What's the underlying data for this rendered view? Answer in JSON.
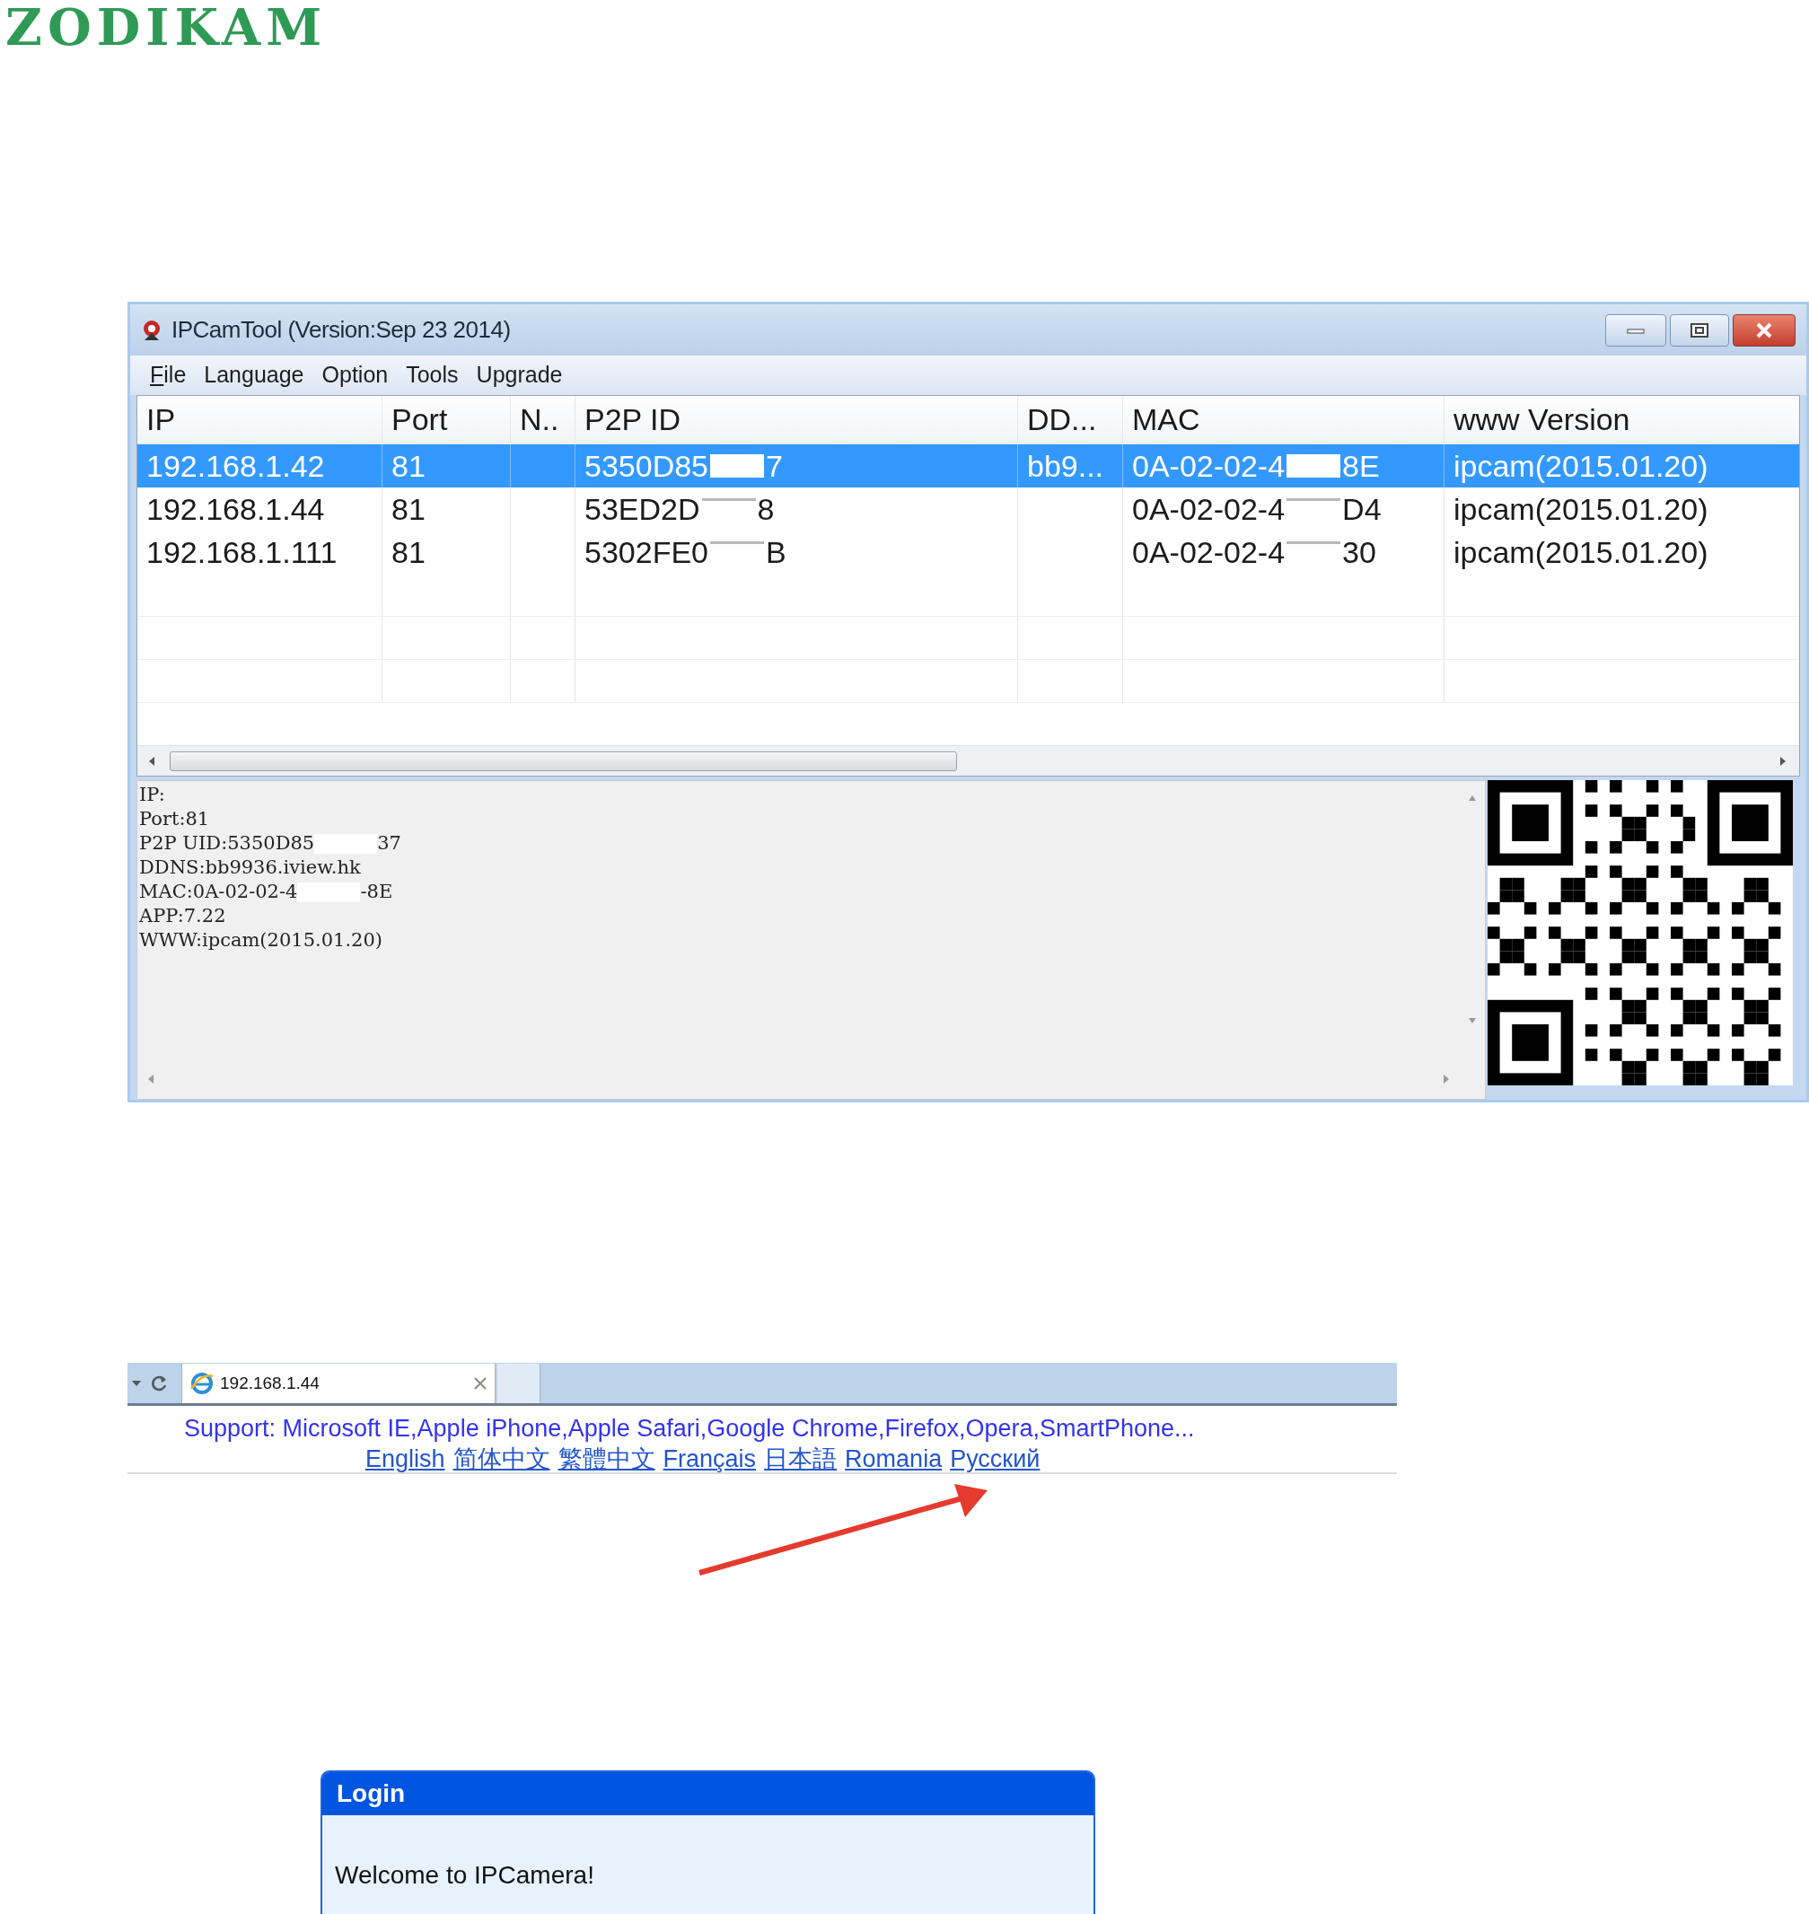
{
  "logo": {
    "text": "ZODIKAM"
  },
  "app_window": {
    "title": "IPCamTool (Version:Sep 23 2014)",
    "menu": [
      {
        "label": "File",
        "underline_first": true
      },
      {
        "label": "Language"
      },
      {
        "label": "Option"
      },
      {
        "label": "Tools"
      },
      {
        "label": "Upgrade"
      }
    ],
    "table": {
      "columns": [
        "IP",
        "Port",
        "N..",
        "P2P ID",
        "DD...",
        "MAC",
        "www Version"
      ],
      "rows": [
        {
          "selected": true,
          "cells": [
            "192.168.1.42",
            "81",
            "",
            {
              "parts": [
                "5350D85",
                "7"
              ]
            },
            "bb9...",
            {
              "parts": [
                "0A-02-02-4",
                "8E"
              ]
            },
            "ipcam(2015.01.20)"
          ]
        },
        {
          "selected": false,
          "cells": [
            "192.168.1.44",
            "81",
            "",
            {
              "parts": [
                "53ED2D",
                "8"
              ]
            },
            "",
            {
              "parts": [
                "0A-02-02-4",
                "D4"
              ]
            },
            "ipcam(2015.01.20)"
          ]
        },
        {
          "selected": false,
          "cells": [
            "192.168.1.111",
            "81",
            "",
            {
              "parts": [
                "5302FE0",
                "B"
              ]
            },
            "",
            {
              "parts": [
                "0A-02-02-4",
                "30"
              ]
            },
            "ipcam(2015.01.20)"
          ]
        }
      ]
    },
    "details": [
      [
        "IP:"
      ],
      [
        "Port:81"
      ],
      [
        "P2P UID:5350D85",
        "37"
      ],
      [
        "DDNS:bb9936.iview.hk"
      ],
      [
        "MAC:0A-02-02-4",
        "-8E"
      ],
      [
        "APP:7.22"
      ],
      [
        "WWW:ipcam(2015.01.20)"
      ]
    ]
  },
  "browser": {
    "tab_title": "192.168.1.44",
    "support": "Support: Microsoft IE,Apple iPhone,Apple Safari,Google Chrome,Firefox,Opera,SmartPhone...",
    "languages": [
      "English",
      "简体中文",
      "繁體中文",
      "Français",
      "日本語",
      "Romania",
      "Русский"
    ]
  },
  "login": {
    "title": "Login",
    "welcome": "Welcome to IPCamera!"
  }
}
